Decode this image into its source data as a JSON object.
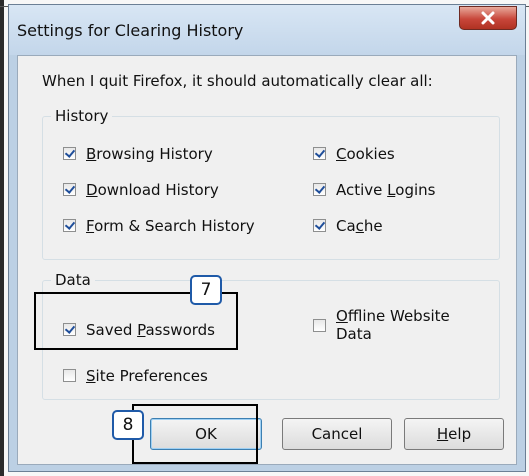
{
  "dialog": {
    "title": "Settings for Clearing History",
    "intro": "When I quit Firefox, it should automatically clear all:"
  },
  "history": {
    "title": "History",
    "items": [
      {
        "pre": "",
        "u": "B",
        "post": "rowsing History",
        "checked": true
      },
      {
        "pre": "",
        "u": "D",
        "post": "ownload History",
        "checked": true
      },
      {
        "pre": "",
        "u": "F",
        "post": "orm & Search History",
        "checked": true
      },
      {
        "pre": "",
        "u": "C",
        "post": "ookies",
        "checked": true
      },
      {
        "pre": "Active ",
        "u": "L",
        "post": "ogins",
        "checked": true
      },
      {
        "pre": "Ca",
        "u": "c",
        "post": "he",
        "checked": true
      }
    ]
  },
  "data_group": {
    "title": "Data",
    "saved_passwords": {
      "pre": "Saved ",
      "u": "P",
      "post": "asswords",
      "checked": true
    },
    "site_preferences": {
      "pre": "",
      "u": "S",
      "post": "ite Preferences",
      "checked": false
    },
    "offline_data": {
      "pre": "",
      "u": "O",
      "post": "ffline Website",
      "line2": "Data",
      "checked": false
    }
  },
  "buttons": {
    "ok": "OK",
    "cancel": "Cancel",
    "help_u": "H",
    "help_post": "elp"
  },
  "annotations": {
    "step7": "7",
    "step8": "8"
  }
}
